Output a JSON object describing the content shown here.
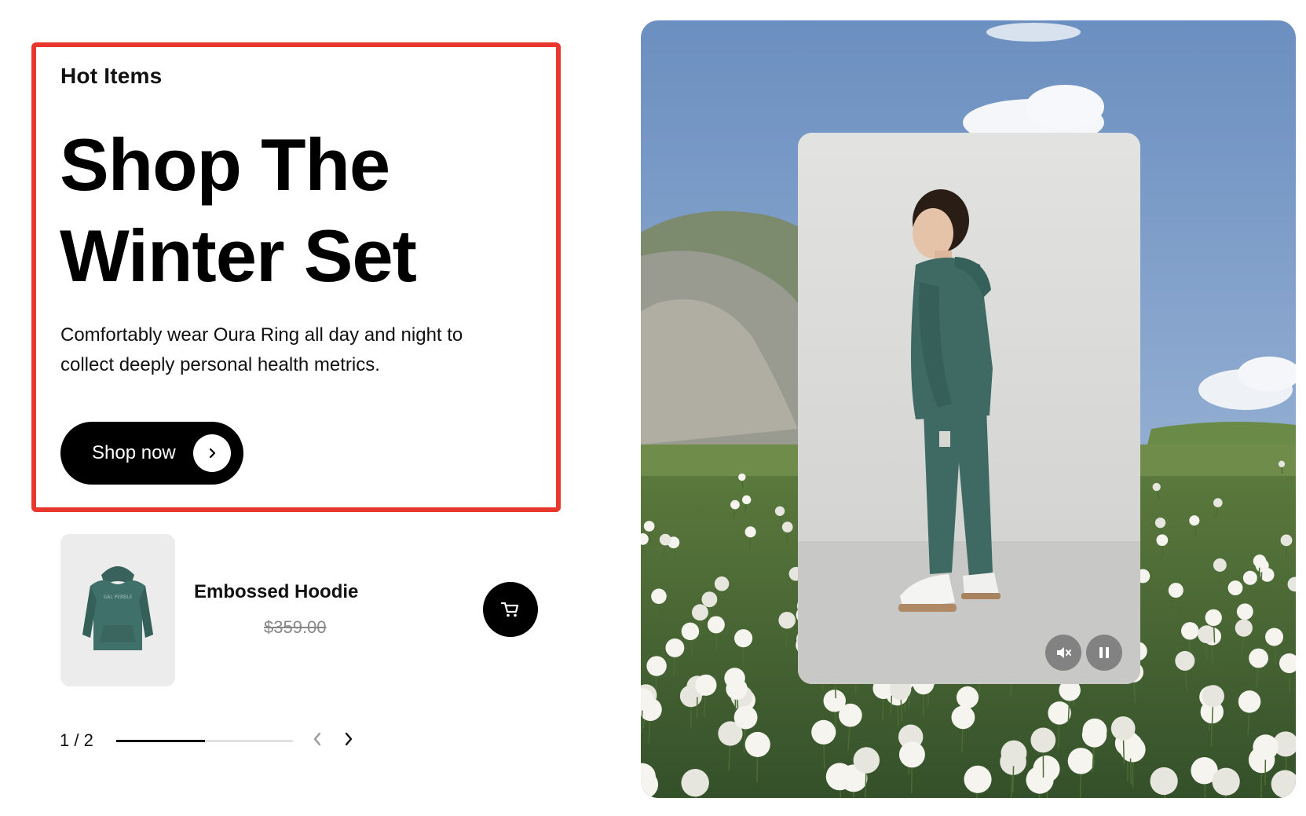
{
  "hero": {
    "eyebrow": "Hot Items",
    "headline_line1": "Shop The",
    "headline_line2": "Winter Set",
    "description_line1": "Comfortably wear Oura Ring all day and night to",
    "description_line2": "collect deeply personal health metrics.",
    "cta_label": "Shop now",
    "cta_icon": "chevron-right-icon"
  },
  "product": {
    "name": "Embossed Hoodie",
    "price": "$359.00",
    "image_color": "#3f6a64",
    "cart_icon": "cart-icon"
  },
  "pager": {
    "text": "1 / 2",
    "progress": 0.5,
    "prev_icon": "chevron-left-icon",
    "next_icon": "chevron-right-icon"
  },
  "media": {
    "mute_icon": "mute-icon",
    "pause_icon": "pause-icon"
  },
  "colors": {
    "highlight_border": "#e8372c",
    "primary": "#000000",
    "outfit": "#3f6a64"
  }
}
